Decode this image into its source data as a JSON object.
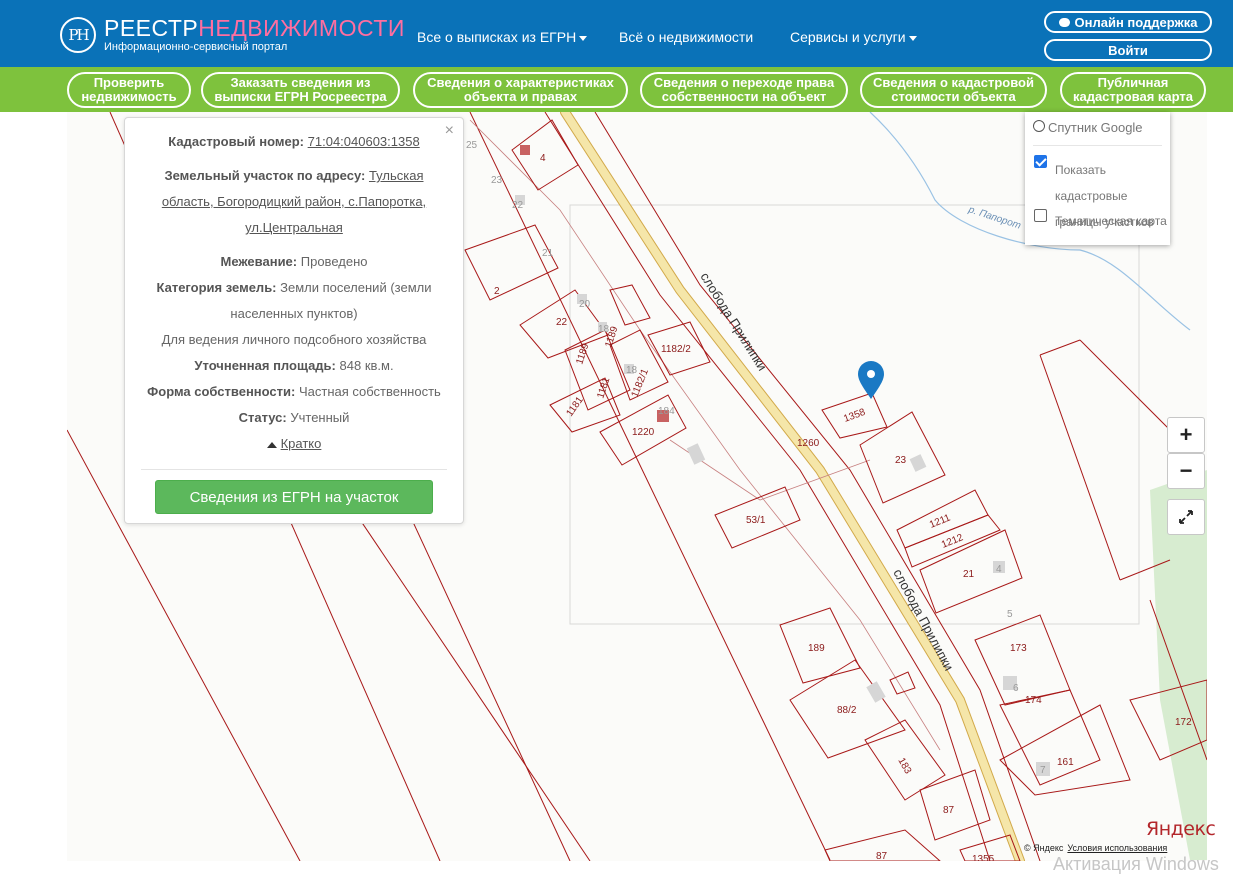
{
  "header": {
    "logo_mark": "РН",
    "logo_title_a": "РЕЕСТР",
    "logo_title_b": "НЕДВИЖИМОСТИ",
    "logo_subtitle": "Информационно-сервисный портал",
    "nav": [
      "Все о выписках из ЕГРН",
      "Всё о недвижимости",
      "Сервисы и услуги"
    ],
    "support_label": "Онлайн поддержка",
    "login_label": "Войти"
  },
  "menu": [
    "Проверить\nнедвижимость",
    "Заказать сведения из\nвыписки ЕГРН Росреестра",
    "Сведения о характеристиках\nобъекта и правах",
    "Сведения о переходе права\nсобственности на объект",
    "Сведения о кадастровой\nстоимости объекта",
    "Публичная\nкадастровая карта"
  ],
  "info": {
    "cadastral_label": "Кадастровый номер:",
    "cadastral_value": "71:04:040603:1358",
    "address_label": "Земельный участок по адресу:",
    "address_line1": "Тульская",
    "address_line2": "область, Богородицкий район, с.Папоротка,",
    "address_line3": "ул.Центральная",
    "survey_label": "Межевание:",
    "survey_value": "Проведено",
    "category_label": "Категория земель:",
    "category_value1": "Земли поселений (земли",
    "category_value2": "населенных пунктов)",
    "purpose": "Для ведения личного подсобного хозяйства",
    "area_label": "Уточненная площадь:",
    "area_value": "848 кв.м.",
    "ownership_label": "Форма собственности:",
    "ownership_value": "Частная собственность",
    "status_label": "Статус:",
    "status_value": "Учтенный",
    "collapse_label": "Кратко",
    "close_symbol": "×",
    "egrn_button": "Сведения из ЕГРН на участок"
  },
  "layers": {
    "satellite": "Спутник Google",
    "cadastral_1": "Показать кадастровые",
    "cadastral_2": "границы участков",
    "thematic": "Тематическая карта",
    "cadastral_checked": true,
    "thematic_checked": false
  },
  "zoom": {
    "plus": "+",
    "minus": "−"
  },
  "map": {
    "street_label": "слобода Прилипки",
    "river_label": "р. Папорот",
    "parcel_labels": [
      "25",
      "4",
      "23",
      "22",
      "21",
      "2",
      "20",
      "22",
      "18",
      "1189",
      "1189",
      "1182/2",
      "18",
      "1182/1",
      "1181",
      "1181",
      "184",
      "1220",
      "1358",
      "1260",
      "23",
      "53/1",
      "1211",
      "1212",
      "21",
      "4",
      "5",
      "173",
      "189",
      "6",
      "174",
      "88/2",
      "172",
      "183",
      "7",
      "161",
      "87",
      "87",
      "1355"
    ],
    "attribution_brand": "Яндекс",
    "attribution_copy": "© Яндекс",
    "attribution_terms": "Условия использования"
  },
  "os_watermark": "Активация Windows",
  "colors": {
    "header_blue": "#0a72b8",
    "menu_green": "#7ec23d",
    "parcel_line": "#a81818",
    "road_yellow": "#f3e3a3",
    "marker_blue": "#1a79c4",
    "button_green": "#5cb85c"
  }
}
